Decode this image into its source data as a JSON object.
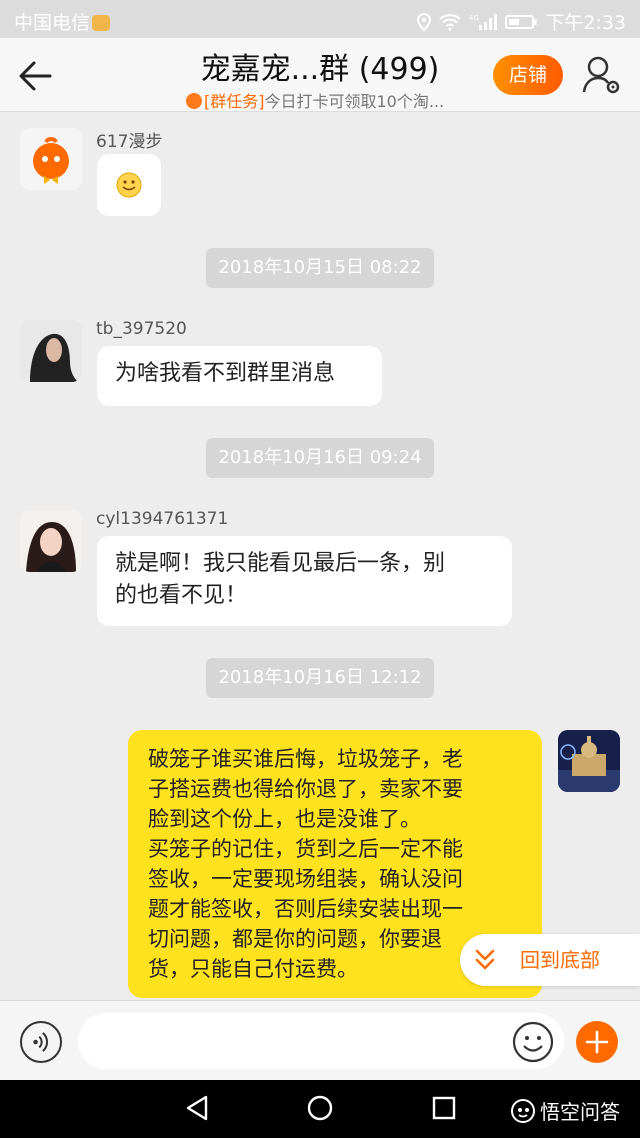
{
  "status_bar": {
    "carrier": "中国电信",
    "network": "4G",
    "time": "下午2:33"
  },
  "header": {
    "title": "宠嘉宠...群 (499)",
    "subtitle_tag": "[群任务]",
    "subtitle_text": "今日打卡可领取10个淘...",
    "shop_label": "店铺"
  },
  "messages": [
    {
      "sender": "617漫步",
      "content_icon": "smiley-emoji"
    },
    {
      "timestamp": "2018年10月15日 08:22"
    },
    {
      "sender": "tb_397520",
      "text": "为啥我看不到群里消息"
    },
    {
      "timestamp": "2018年10月16日 09:24"
    },
    {
      "sender": "cyl1394761371",
      "text_lines": [
        "就是啊！我只能看见最后一条，别",
        "的也看不见！"
      ]
    },
    {
      "timestamp": "2018年10月16日 12:12"
    },
    {
      "sender": "",
      "self": true,
      "text_lines": [
        "破笼子谁买谁后悔，垃圾笼子，老",
        "子搭运费也得给你退了，卖家不要",
        "脸到这个份上，也是没谁了。",
        "买笼子的记住，货到之后一定不能",
        "签收，一定要现场组装，确认没问",
        "题才能签收，否则后续安装出现一",
        "切问题，都是你的问题，你要退",
        "货，只能自己付运费。"
      ]
    }
  ],
  "floating": {
    "back_to_bottom": "回到底部"
  },
  "watermark": {
    "text": "悟空问答"
  },
  "colors": {
    "accent": "#ff6a00",
    "self_bubble": "#ffe21e"
  },
  "icons": [
    "back-arrow-icon",
    "profile-settings-icon",
    "voice-icon",
    "emoji-icon",
    "plus-icon",
    "chevron-down-icon"
  ]
}
